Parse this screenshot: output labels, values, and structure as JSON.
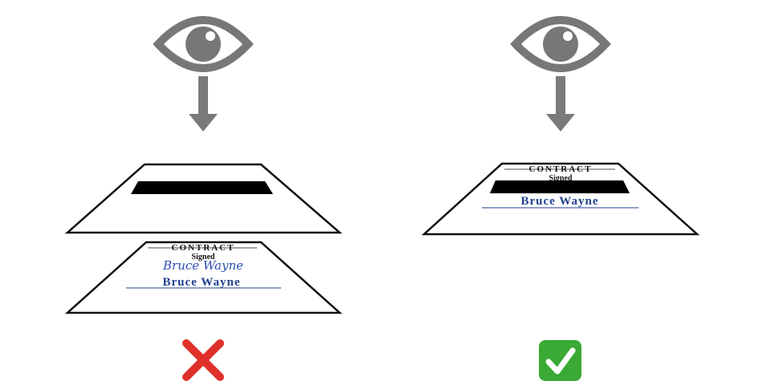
{
  "colors": {
    "eye": "#777777",
    "arrow": "#7a7a7a",
    "paper_border": "#111111",
    "redaction": "#000000",
    "ink_blue": "#1f3f8f",
    "signature_blue": "#2b4fb3",
    "wrong_red": "#e0302a",
    "right_green": "#3aaa35"
  },
  "left": {
    "verdict_icon": "cross-mark-icon",
    "document": {
      "title": "CONTRACT",
      "signed_label": "Signed",
      "signature": "Bruce Wayne",
      "name": "Bruce Wayne"
    }
  },
  "right": {
    "verdict_icon": "check-mark-icon",
    "document": {
      "title": "CONTRACT",
      "signed_label": "Signed",
      "name": "Bruce Wayne"
    }
  }
}
